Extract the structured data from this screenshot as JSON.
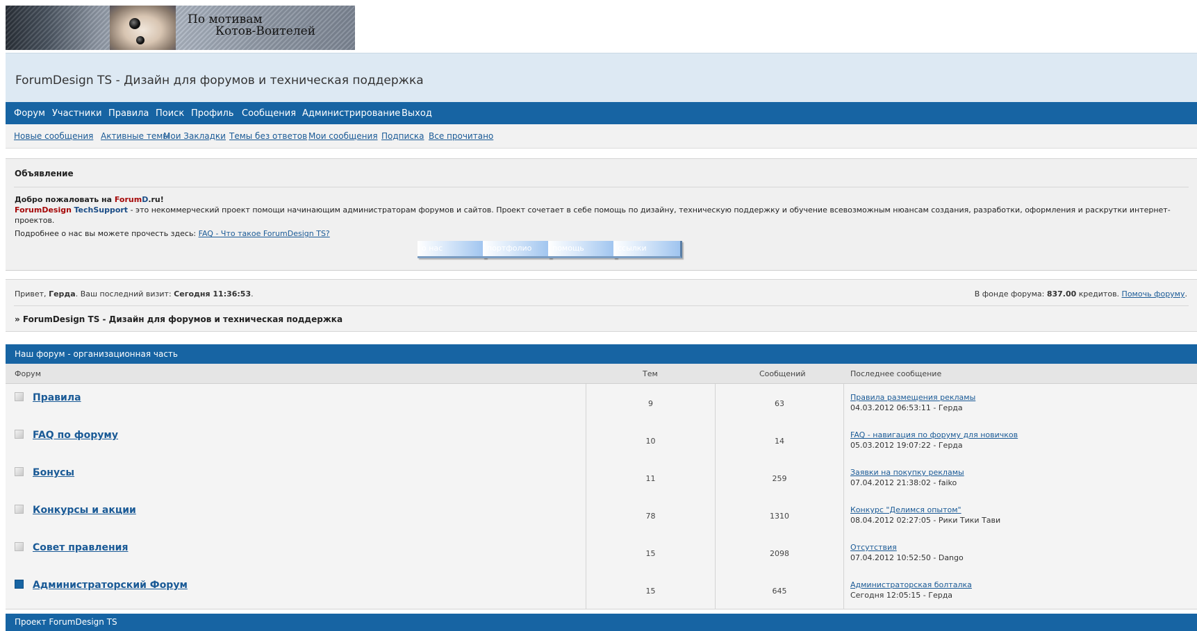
{
  "banner": {
    "line1": "По мотивам",
    "line2": "Котов-Воителей"
  },
  "header": {
    "title": "ForumDesign TS - Дизайн для форумов и техническая поддержка"
  },
  "main_nav": [
    "Форум",
    "Участники",
    "Правила",
    "Поиск",
    "Профиль",
    "Сообщения",
    "Администрирование",
    "Выход"
  ],
  "sub_nav": [
    "Новые сообщения",
    "Активные темы",
    "Мои Закладки",
    "Темы без ответов",
    "Мои сообщения",
    "Подписка",
    "Все прочитано"
  ],
  "announcement": {
    "heading": "Объявление",
    "welcome_prefix": "Добро пожаловать на ",
    "welcome_brand_a": "Forum",
    "welcome_brand_b": "D",
    "welcome_brand_c": ".ru!",
    "desc_brand_a": "ForumDesign",
    "desc_brand_b": "TechSupport",
    "desc_text": " - это некоммерческий проект помощи начинающим администраторам форумов и сайтов. Проект сочетает в себе помощь по дизайну, техническую поддержку и обучение всевозможным нюансам создания, разработки, оформления и раскрутки интернет-проектов.",
    "more_prefix": "Подробнее о нас вы можете прочесть здесь: ",
    "more_link": "FAQ - Что такое ForumDesign TS?",
    "buttons": [
      "о нас",
      "портфолио",
      "помощь",
      "ссылки"
    ]
  },
  "welcome": {
    "greeting": "Привет, ",
    "username": "Герда",
    "visit_prefix": ".  Ваш последний визит: ",
    "visit_value": "Сегодня 11:36:53",
    "visit_suffix": ".",
    "fund_prefix": "В фонде форума: ",
    "fund_value": "837.00",
    "fund_suffix": " кредитов. ",
    "fund_link": "Помочь форуму",
    "fund_end": ".",
    "breadcrumb": "» ForumDesign TS - Дизайн для форумов и техническая поддержка"
  },
  "category": {
    "title": "Наш форум - организационная часть",
    "columns": [
      "Форум",
      "Тем",
      "Сообщений",
      "Последнее сообщение"
    ],
    "forums": [
      {
        "name": "Правила",
        "topics": "9",
        "posts": "63",
        "last_title": "Правила размещения рекламы",
        "last_meta": "04.03.2012 06:53:11 - Герда",
        "new": false
      },
      {
        "name": "FAQ по форуму",
        "topics": "10",
        "posts": "14",
        "last_title": "FAQ - навигация по форуму для новичков",
        "last_meta": "05.03.2012 19:07:22 - Герда",
        "new": false
      },
      {
        "name": "Бонусы",
        "topics": "11",
        "posts": "259",
        "last_title": "Заявки на покупку рекламы",
        "last_meta": "07.04.2012 21:38:02 - faiko",
        "new": false
      },
      {
        "name": "Конкурсы и акции",
        "topics": "78",
        "posts": "1310",
        "last_title": "Конкурс \"Делимся опытом\"",
        "last_meta": "08.04.2012 02:27:05 - Рики Тики Тави",
        "new": false
      },
      {
        "name": "Совет правления",
        "topics": "15",
        "posts": "2098",
        "last_title": "Отсутствия",
        "last_meta": "07.04.2012 10:52:50 - Dango",
        "new": false
      },
      {
        "name": "Администраторский Форум",
        "topics": "15",
        "posts": "645",
        "last_title": "Администраторская болталка",
        "last_meta": "Сегодня 12:05:15 - Герда",
        "new": true
      }
    ]
  },
  "footer_category": {
    "title": "Проект ForumDesign TS"
  }
}
